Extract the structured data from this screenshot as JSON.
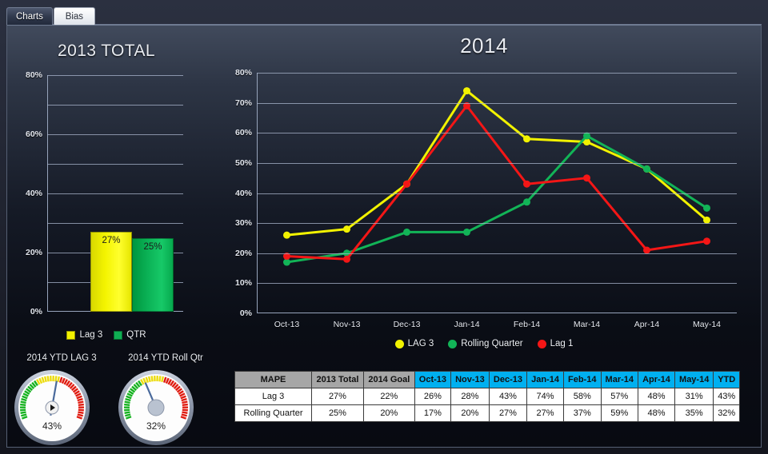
{
  "tabs": [
    {
      "label": "Charts",
      "active": true
    },
    {
      "label": "Bias",
      "active": false
    }
  ],
  "panels": {
    "left_title": "2013 TOTAL",
    "main_title": "2014"
  },
  "colors": {
    "lag3": "#f2f200",
    "rolling_quarter": "#12b457",
    "lag1": "#f41616",
    "qtr_bar": "#0fae53",
    "table_header_gray": "#a6a6a6",
    "table_header_cyan": "#00b0f0"
  },
  "bar_legend": [
    {
      "label": "Lag 3",
      "color": "#f2f200"
    },
    {
      "label": "QTR",
      "color": "#0fae53"
    }
  ],
  "line_legend": [
    {
      "label": "LAG 3",
      "color": "#f2f200"
    },
    {
      "label": "Rolling Quarter",
      "color": "#12b457"
    },
    {
      "label": "Lag 1",
      "color": "#f41616"
    }
  ],
  "gauges": [
    {
      "title": "2014 YTD LAG 3",
      "value_label": "43%",
      "value": 43
    },
    {
      "title": "2014 YTD Roll Qtr",
      "value_label": "32%",
      "value": 32
    }
  ],
  "table": {
    "headers": [
      "MAPE",
      "2013 Total",
      "2014 Goal",
      "Oct-13",
      "Nov-13",
      "Dec-13",
      "Jan-14",
      "Feb-14",
      "Mar-14",
      "Apr-14",
      "May-14",
      "YTD"
    ],
    "rows": [
      {
        "label": "Lag 3",
        "values": [
          "27%",
          "22%",
          "26%",
          "28%",
          "43%",
          "74%",
          "58%",
          "57%",
          "48%",
          "31%",
          "43%"
        ]
      },
      {
        "label": "Rolling Quarter",
        "values": [
          "25%",
          "20%",
          "17%",
          "20%",
          "27%",
          "27%",
          "37%",
          "59%",
          "48%",
          "35%",
          "32%"
        ]
      }
    ]
  },
  "chart_data": [
    {
      "type": "bar",
      "title": "2013 TOTAL",
      "categories": [
        "Lag 3",
        "QTR"
      ],
      "values": [
        27,
        25
      ],
      "value_labels": [
        "27%",
        "25%"
      ],
      "colors": [
        "#f2f200",
        "#0fae53"
      ],
      "ylabel": "",
      "xlabel": "",
      "ylim": [
        0,
        80
      ],
      "yticks": [
        0,
        20,
        40,
        60,
        80
      ],
      "ytick_labels": [
        "0%",
        "20%",
        "40%",
        "60%",
        "80%"
      ],
      "gridlines_every": 10,
      "grid": true,
      "legend_position": "bottom"
    },
    {
      "type": "line",
      "title": "2014",
      "x": [
        "Oct-13",
        "Nov-13",
        "Dec-13",
        "Jan-14",
        "Feb-14",
        "Mar-14",
        "Apr-14",
        "May-14"
      ],
      "series": [
        {
          "name": "LAG 3",
          "color": "#f2f200",
          "values": [
            26,
            28,
            43,
            74,
            58,
            57,
            48,
            31
          ]
        },
        {
          "name": "Rolling Quarter",
          "color": "#12b457",
          "values": [
            17,
            20,
            27,
            27,
            37,
            59,
            48,
            35
          ]
        },
        {
          "name": "Lag 1",
          "color": "#f41616",
          "values": [
            19,
            18,
            43,
            69,
            43,
            45,
            21,
            24
          ]
        }
      ],
      "ylabel": "",
      "xlabel": "",
      "ylim": [
        0,
        80
      ],
      "yticks": [
        0,
        10,
        20,
        30,
        40,
        50,
        60,
        70,
        80
      ],
      "ytick_labels": [
        "0%",
        "10%",
        "20%",
        "30%",
        "40%",
        "50%",
        "60%",
        "70%",
        "80%"
      ],
      "grid": true,
      "legend_position": "bottom"
    }
  ]
}
